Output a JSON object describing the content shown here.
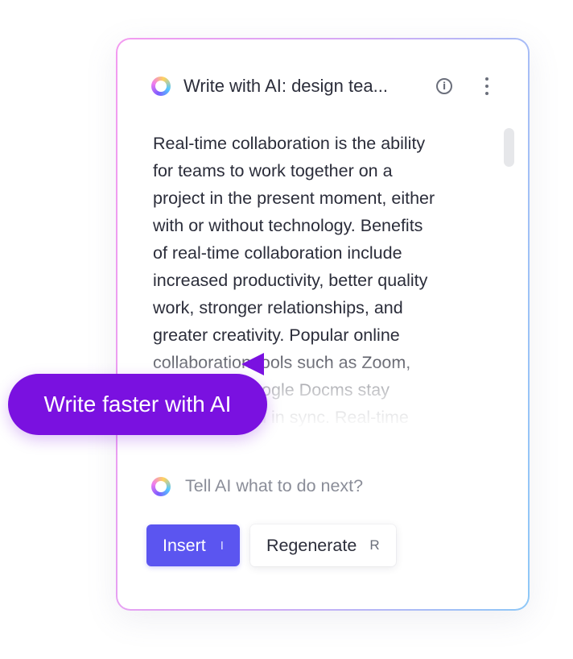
{
  "panel": {
    "title": "Write with AI: design tea...",
    "info_icon": "info-icon",
    "more_icon": "more-vertical-icon",
    "body_lines": [
      "Real-time collaboration is the ability",
      "for teams to work together on a",
      "project in the present moment, either",
      "with or without technology. Benefits",
      "of real-time collaboration include",
      "increased productivity, better quality",
      "work, stronger relationships, and",
      "greater creativity. Popular online",
      "collaboration tools such as Zoom,",
      "Slack, and Google Docms stay",
      "connected and in sync. Real-time"
    ],
    "prompt_placeholder": "Tell AI what to do next?",
    "insert_label": "Insert",
    "insert_shortcut": "I",
    "regenerate_label": "Regenerate",
    "regenerate_shortcut": "R"
  },
  "callout": {
    "label": "Write faster with AI"
  },
  "colors": {
    "accent": "#5b55f0",
    "callout": "#7a11e0",
    "text": "#2b2d3a",
    "muted": "#8a8d98"
  }
}
